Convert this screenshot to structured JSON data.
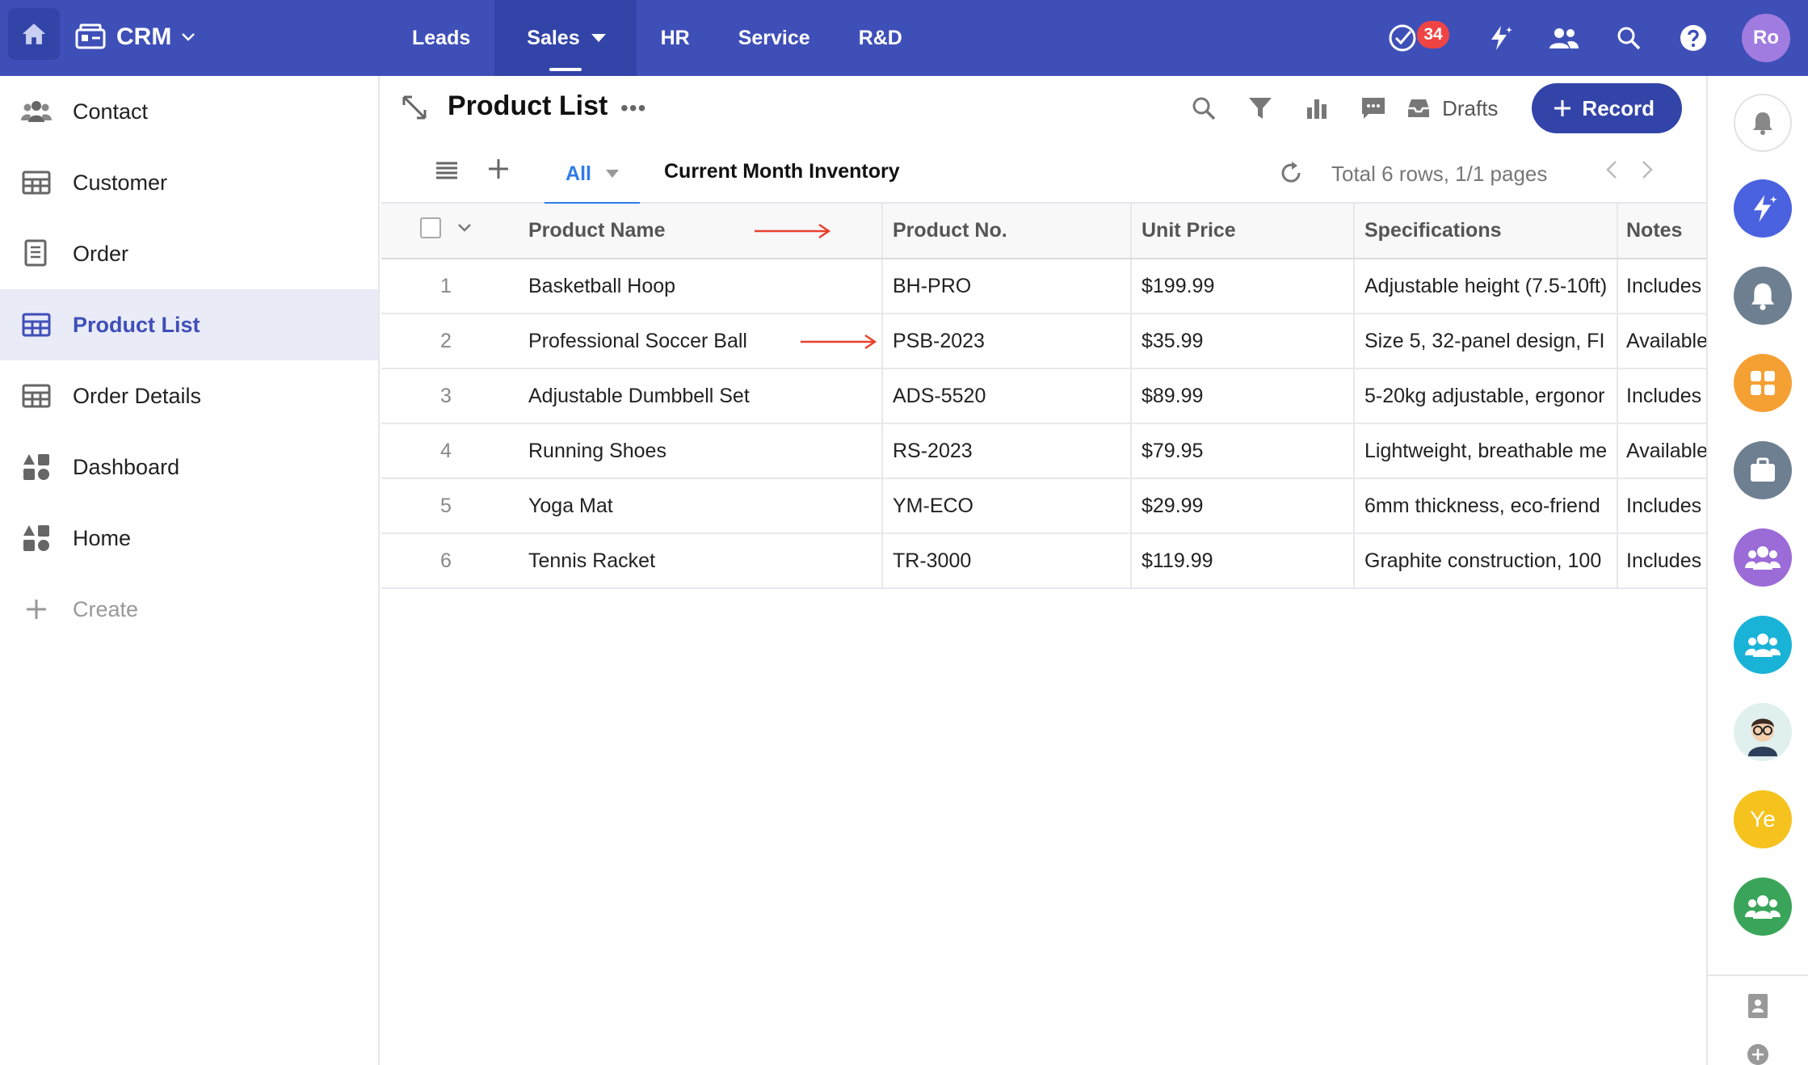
{
  "app": {
    "name": "CRM",
    "nav": [
      {
        "label": "Leads"
      },
      {
        "label": "Sales"
      },
      {
        "label": "HR"
      },
      {
        "label": "Service"
      },
      {
        "label": "R&D"
      }
    ],
    "task_count": "34",
    "user_initials": "Ro"
  },
  "sidebar": {
    "items": [
      {
        "label": "Contact",
        "icon": "contacts-icon"
      },
      {
        "label": "Customer",
        "icon": "grid-table-icon"
      },
      {
        "label": "Order",
        "icon": "document-list-icon"
      },
      {
        "label": "Product List",
        "icon": "grid-table-icon"
      },
      {
        "label": "Order Details",
        "icon": "grid-table-icon"
      },
      {
        "label": "Dashboard",
        "icon": "dashboard-shapes-icon"
      },
      {
        "label": "Home",
        "icon": "dashboard-shapes-icon"
      }
    ],
    "active_index": 3,
    "create_label": "Create"
  },
  "page": {
    "title": "Product List",
    "drafts_label": "Drafts",
    "record_label": "Record",
    "tabs": {
      "all": "All",
      "month": "Current Month Inventory"
    },
    "rows_info": "Total 6 rows, 1/1 pages"
  },
  "table": {
    "columns": [
      "Product Name",
      "Product No.",
      "Unit Price",
      "Specifications",
      "Notes"
    ],
    "rows": [
      {
        "idx": "1",
        "name": "Basketball Hoop",
        "no": "BH-PRO",
        "price": "$199.99",
        "spec": "Adjustable height (7.5-10ft)",
        "notes": "Includes"
      },
      {
        "idx": "2",
        "name": "Professional Soccer Ball",
        "no": "PSB-2023",
        "price": "$35.99",
        "spec": "Size 5, 32-panel design, FI",
        "notes": "Available"
      },
      {
        "idx": "3",
        "name": "Adjustable Dumbbell Set",
        "no": "ADS-5520",
        "price": "$89.99",
        "spec": "5-20kg adjustable, ergonor",
        "notes": "Includes"
      },
      {
        "idx": "4",
        "name": "Running Shoes",
        "no": "RS-2023",
        "price": "$79.95",
        "spec": "Lightweight, breathable me",
        "notes": "Available"
      },
      {
        "idx": "5",
        "name": "Yoga Mat",
        "no": "YM-ECO",
        "price": "$29.99",
        "spec": "6mm thickness, eco-friend",
        "notes": "Includes"
      },
      {
        "idx": "6",
        "name": "Tennis Racket",
        "no": "TR-3000",
        "price": "$119.99",
        "spec": "Graphite construction, 100",
        "notes": "Includes"
      }
    ]
  },
  "rail": {
    "ye_initials": "Ye"
  },
  "colors": {
    "topbar": "#3f4fb8",
    "accent": "#3344a8",
    "tab_active": "#2f7be8",
    "badge": "#f04444",
    "annotation_arrow": "#e8402c"
  }
}
